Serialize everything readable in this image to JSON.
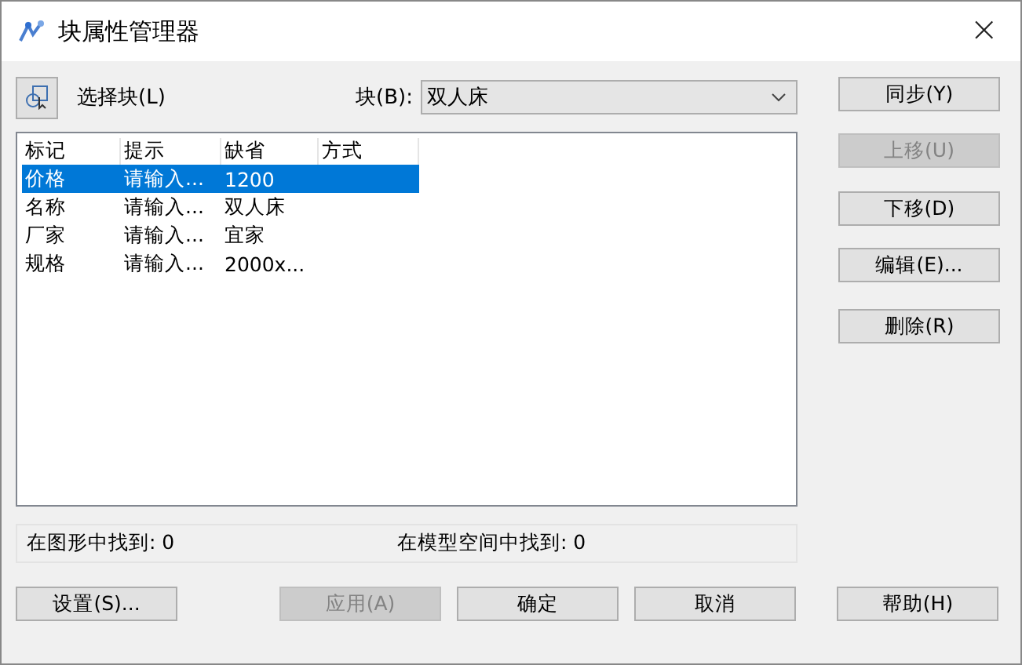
{
  "window": {
    "title": "块属性管理器",
    "close": "×"
  },
  "select_block": {
    "label": "选择块(L)"
  },
  "block_field": {
    "label": "块(B):",
    "value": "双人床"
  },
  "table": {
    "columns": [
      "标记",
      "提示",
      "缺省",
      "方式"
    ],
    "rows": [
      {
        "cells": [
          "价格",
          "请输入...",
          "1200",
          ""
        ],
        "selected": true
      },
      {
        "cells": [
          "名称",
          "请输入...",
          "双人床",
          ""
        ],
        "selected": false
      },
      {
        "cells": [
          "厂家",
          "请输入...",
          "宜家",
          ""
        ],
        "selected": false
      },
      {
        "cells": [
          "规格",
          "请输入...",
          "2000x...",
          ""
        ],
        "selected": false
      }
    ]
  },
  "side_buttons": [
    {
      "label": "同步(Y)",
      "disabled": false
    },
    {
      "label": "上移(U)",
      "disabled": true
    },
    {
      "label": "下移(D)",
      "disabled": false
    },
    {
      "label": "编辑(E)...",
      "disabled": false
    },
    {
      "label": "删除(R)",
      "disabled": false
    }
  ],
  "status": {
    "in_drawing": "在图形中找到: 0",
    "in_model_space": "在模型空间中找到: 0"
  },
  "bottom_buttons": [
    {
      "label": "设置(S)...",
      "disabled": false
    },
    {
      "label": "应用(A)",
      "disabled": true
    },
    {
      "label": "确定",
      "disabled": false
    },
    {
      "label": "取消",
      "disabled": false
    },
    {
      "label": "帮助(H)",
      "disabled": false
    }
  ]
}
